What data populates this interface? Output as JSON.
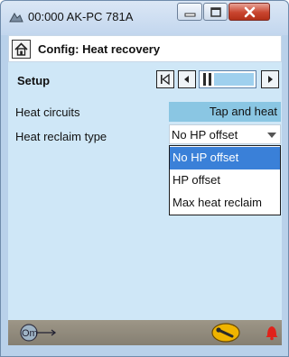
{
  "window": {
    "title": "00:000 AK-PC 781A"
  },
  "header": {
    "title": "Config: Heat recovery"
  },
  "setup": {
    "label": "Setup"
  },
  "rows": [
    {
      "label": "Heat circuits",
      "value": "Tap and heat"
    },
    {
      "label": "Heat reclaim type",
      "value": "No HP offset"
    }
  ],
  "dropdown": {
    "options": [
      "No HP offset",
      "HP offset",
      "Max heat reclaim"
    ],
    "selected": "No HP offset"
  },
  "colors": {
    "selection": "#3a80d8",
    "value_fill": "#8ac6e3",
    "panel": "#cfe7f7",
    "alarm": "#e0221a"
  },
  "icons": [
    "app-icon",
    "minimize-icon",
    "maximize-icon",
    "close-icon",
    "home-icon",
    "first-page-icon",
    "prev-page-icon",
    "next-page-icon",
    "dropdown-arrow-icon",
    "login-icon",
    "service-key-icon",
    "alarm-bell-icon"
  ]
}
